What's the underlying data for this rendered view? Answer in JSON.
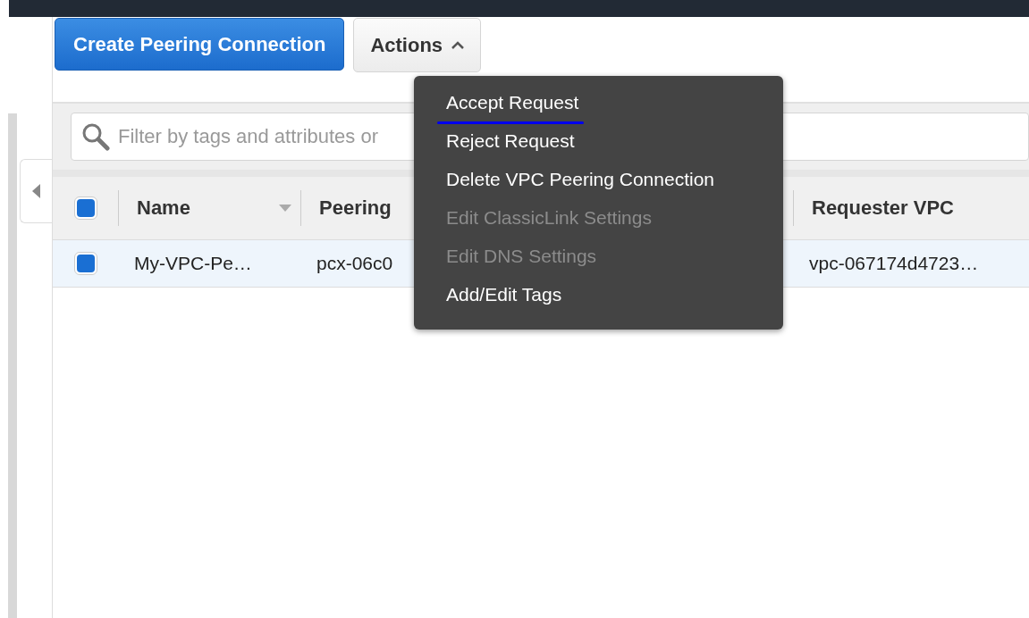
{
  "toolbar": {
    "create_button": "Create Peering Connection",
    "actions_button": {
      "label": "Actions",
      "expanded": true
    }
  },
  "filter": {
    "placeholder": "Filter by tags and attributes or"
  },
  "table": {
    "select_all": {
      "checked": true
    },
    "columns": [
      {
        "label": "Name",
        "sortable": true
      },
      {
        "label": "Peering",
        "sortable": false
      },
      {
        "label": "Requester VPC",
        "sortable": false
      }
    ],
    "rows": [
      {
        "selected": true,
        "cells": [
          "My-VPC-Pe…",
          "pcx-06c0",
          "vpc-067174d4723…"
        ]
      }
    ]
  },
  "actions_menu": [
    {
      "label": "Accept Request",
      "disabled": false,
      "underlined": true
    },
    {
      "label": "Reject Request",
      "disabled": false,
      "underlined": false
    },
    {
      "label": "Delete VPC Peering Connection",
      "disabled": false,
      "underlined": false
    },
    {
      "label": "Edit ClassicLink Settings",
      "disabled": true,
      "underlined": false
    },
    {
      "label": "Edit DNS Settings",
      "disabled": true,
      "underlined": false
    },
    {
      "label": "Add/Edit Tags",
      "disabled": false,
      "underlined": false
    }
  ]
}
